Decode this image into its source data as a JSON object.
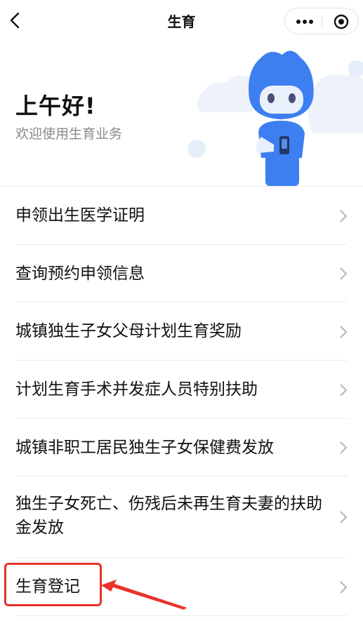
{
  "header": {
    "title": "生育",
    "more_icon": "more-dots-icon",
    "close_icon": "target-circle-icon",
    "back_icon": "chevron-left-icon"
  },
  "hero": {
    "greeting": "上午好!",
    "subtitle": "欢迎使用生育业务",
    "mascot": "blue-robot-mascot"
  },
  "menu": {
    "items": [
      {
        "label": "申领出生医学证明"
      },
      {
        "label": "查询预约申领信息"
      },
      {
        "label": "城镇独生子女父母计划生育奖励"
      },
      {
        "label": "计划生育手术并发症人员特别扶助"
      },
      {
        "label": "城镇非职工居民独生子女保健费发放"
      },
      {
        "label": "独生子女死亡、伤残后未再生育夫妻的扶助金发放"
      },
      {
        "label": "生育登记"
      }
    ]
  },
  "annotation": {
    "highlight_color": "#e8332a"
  },
  "colors": {
    "mascot_blue": "#3d7ff0",
    "divider": "#ececec",
    "subtitle": "#8a8a8a"
  }
}
